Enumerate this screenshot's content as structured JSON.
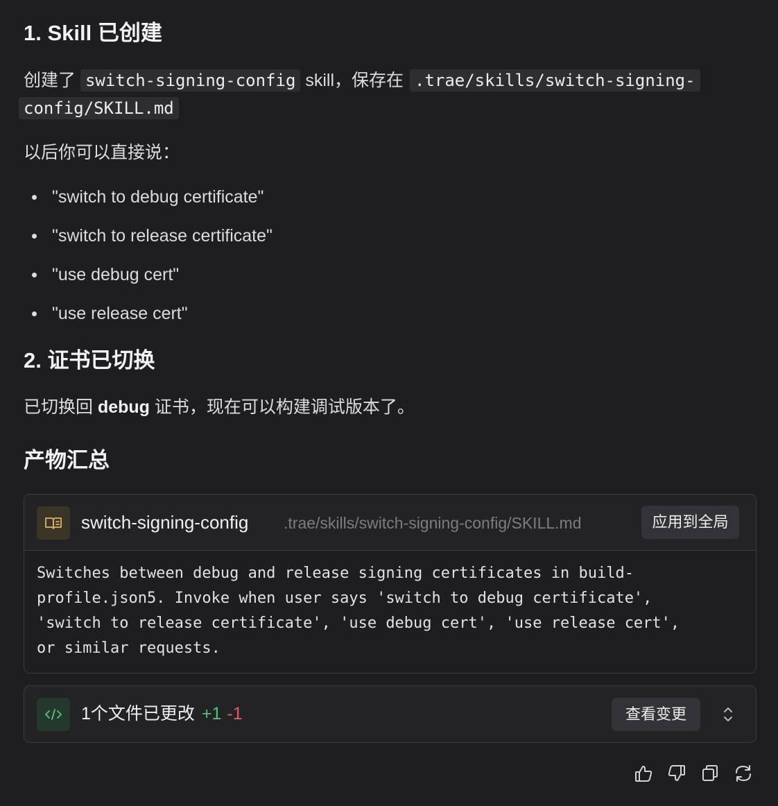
{
  "section1": {
    "title": "1. Skill 已创建",
    "created_prefix": "创建了",
    "skill_code": "switch-signing-config",
    "created_middle": "skill，保存在",
    "path_code_part1": ".trae/skills/switch-signing-",
    "path_code_part2": "config/SKILL.md",
    "say_intro": "以后你可以直接说：",
    "phrases": [
      "\"switch to debug certificate\"",
      "\"switch to release certificate\"",
      "\"use debug cert\"",
      "\"use release cert\""
    ]
  },
  "section2": {
    "title": "2. 证书已切换",
    "text_prefix": "已切换回",
    "text_bold": "debug",
    "text_suffix": "证书，现在可以构建调试版本了。"
  },
  "artifacts": {
    "title": "产物汇总",
    "skill_card": {
      "icon": "book-icon",
      "name": "switch-signing-config",
      "path": ".trae/skills/switch-signing-config/SKILL.md",
      "apply_label": "应用到全局",
      "description": "Switches between debug and release signing certificates in build-\nprofile.json5. Invoke when user says 'switch to debug certificate',\n'switch to release certificate', 'use debug cert', 'use release cert',\nor similar requests."
    },
    "changes": {
      "icon": "code-icon",
      "label": "1个文件已更改",
      "added": "+1",
      "removed": "-1",
      "view_label": "查看变更",
      "toggle_icon": "chevron-up-down-icon"
    }
  },
  "actions": [
    "thumbs-up-icon",
    "thumbs-down-icon",
    "copy-icon",
    "refresh-icon"
  ],
  "colors": {
    "background": "#1e1e20",
    "card_header": "#232326",
    "border": "#3a3a3e",
    "added": "#4fc27a",
    "removed": "#e85c5c",
    "skill_icon_accent": "#d9b46a",
    "code_icon_accent": "#52c785"
  }
}
